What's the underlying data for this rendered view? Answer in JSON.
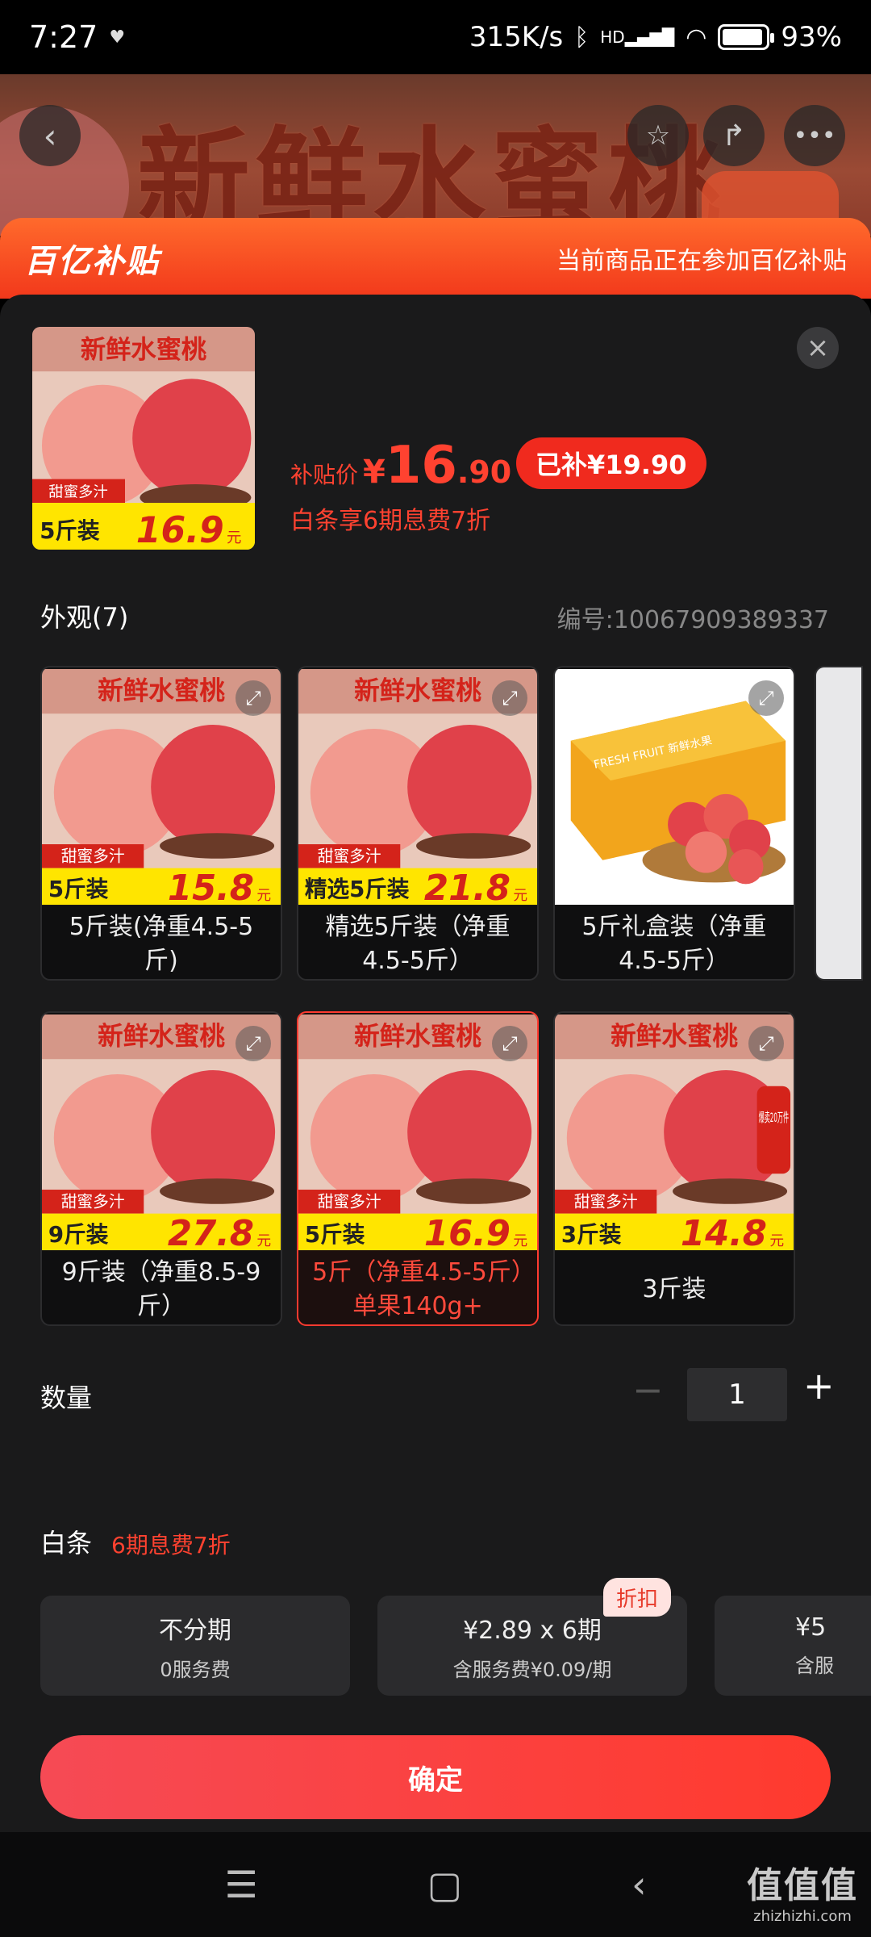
{
  "status_bar": {
    "time": "7:27",
    "speed": "315K/s",
    "network": "HD",
    "battery": "93%",
    "battery_level": 0.93
  },
  "hero": {
    "title": "新鲜水蜜桃"
  },
  "banner": {
    "logo": "百亿补贴",
    "note": "当前商品正在参加百亿补贴"
  },
  "product": {
    "thumb_title": "新鲜水蜜桃",
    "thumb_tag": "甜蜜多汁",
    "thumb_pack": "5斤装",
    "thumb_price": "16.9",
    "thumb_unit": "元",
    "price_label": "补贴价",
    "currency": "¥",
    "price_int": "16",
    "price_dec": ".90",
    "subsidy_badge": "已补¥19.90",
    "installment_note": "白条享6期息费7折"
  },
  "variants": {
    "title": "外观(7)",
    "sku_no": "编号:10067909389337",
    "items": [
      {
        "label": "5斤装(净重4.5-5斤)",
        "img_title": "新鲜水蜜桃",
        "img_tag": "甜蜜多汁",
        "img_pack": "5斤装",
        "img_price": "15.8",
        "img_unit": "元",
        "selected": false
      },
      {
        "label": "精选5斤装（净重4.5-5斤）",
        "img_title": "新鲜水蜜桃",
        "img_tag": "甜蜜多汁",
        "img_pack": "精选5斤装",
        "img_price": "21.8",
        "img_unit": "元",
        "selected": false
      },
      {
        "label": "5斤礼盒装（净重4.5-5斤）",
        "img_box_text": "FRESH FRUIT 新鲜水果",
        "selected": false
      },
      {
        "label": "9斤装（净重8.5-9斤）",
        "img_title": "新鲜水蜜桃",
        "img_tag": "甜蜜多汁",
        "img_pack": "9斤装",
        "img_price": "27.8",
        "img_unit": "元",
        "selected": false
      },
      {
        "label": "5斤（净重4.5-5斤）单果140g+",
        "img_title": "新鲜水蜜桃",
        "img_tag": "甜蜜多汁",
        "img_pack": "5斤装",
        "img_price": "16.9",
        "img_unit": "元",
        "selected": true
      },
      {
        "label": "3斤装",
        "img_title": "新鲜水蜜桃",
        "img_tag": "甜蜜多汁",
        "img_pack": "3斤装",
        "img_price": "14.8",
        "img_unit": "元",
        "img_hot": "爆卖20万件",
        "selected": false
      }
    ]
  },
  "quantity": {
    "label": "数量",
    "value": "1",
    "minus": "−",
    "plus": "+"
  },
  "installment": {
    "title": "白条",
    "tag": "6期息费7折",
    "discount_tag": "折扣",
    "plans": [
      {
        "title": "不分期",
        "sub": "0服务费"
      },
      {
        "title": "¥2.89 x 6期",
        "sub": "含服务费¥0.09/期"
      },
      {
        "title": "¥5",
        "sub": "含服"
      }
    ]
  },
  "confirm_label": "确定",
  "watermark": {
    "main": "值值值",
    "sub": "zhizhizhi.com"
  },
  "colors": {
    "accent": "#ff3b30",
    "sheet": "#1a1a1b",
    "banner": "#f2381b"
  }
}
